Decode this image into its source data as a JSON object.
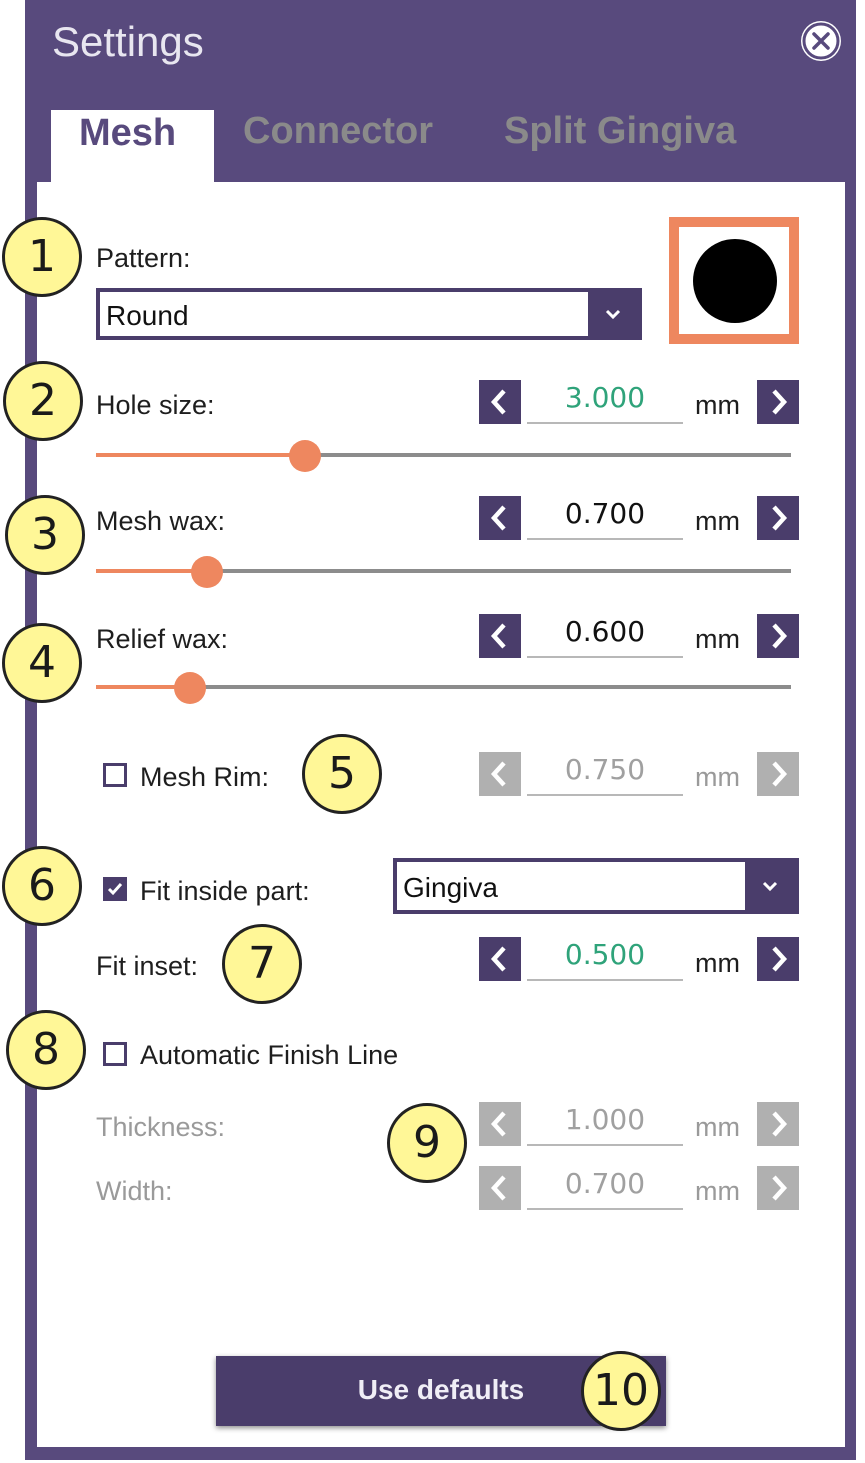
{
  "window": {
    "title": "Settings"
  },
  "tabs": [
    {
      "label": "Mesh",
      "active": true
    },
    {
      "label": "Connector",
      "active": false
    },
    {
      "label": "Split Gingiva",
      "active": false
    }
  ],
  "pattern": {
    "label": "Pattern:",
    "value": "Round"
  },
  "hole_size": {
    "label": "Hole size:",
    "value": "3.000",
    "unit": "mm",
    "slider_fraction": 0.3
  },
  "mesh_wax": {
    "label": "Mesh wax:",
    "value": "0.700",
    "unit": "mm",
    "slider_fraction": 0.16
  },
  "relief_wax": {
    "label": "Relief wax:",
    "value": "0.600",
    "unit": "mm",
    "slider_fraction": 0.135
  },
  "mesh_rim": {
    "label": "Mesh Rim:",
    "value": "0.750",
    "unit": "mm",
    "checked": false
  },
  "fit_inside": {
    "label": "Fit inside part:",
    "checked": true,
    "value": "Gingiva"
  },
  "fit_inset": {
    "label": "Fit inset:",
    "value": "0.500",
    "unit": "mm"
  },
  "auto_finish": {
    "label": "Automatic Finish Line",
    "checked": false
  },
  "thickness": {
    "label": "Thickness:",
    "value": "1.000",
    "unit": "mm"
  },
  "width": {
    "label": "Width:",
    "value": "0.700",
    "unit": "mm"
  },
  "defaults_button": {
    "label": "Use defaults"
  },
  "callouts": [
    "1",
    "2",
    "3",
    "4",
    "5",
    "6",
    "7",
    "8",
    "9",
    "10"
  ],
  "colors": {
    "frame": "#584a7d",
    "control": "#4a3d6b",
    "accent": "#ee875f",
    "value_green": "#2fa37a",
    "callout": "#fff797"
  },
  "icons": [
    "close-icon",
    "chevron-down-icon",
    "chevron-left-icon",
    "chevron-right-icon",
    "checkmark-icon"
  ]
}
